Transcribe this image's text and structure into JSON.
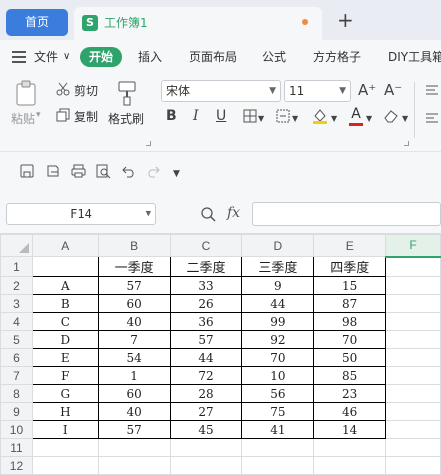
{
  "tabs": {
    "home": "首页",
    "doc_icon": "S",
    "doc_title": "工作簿1",
    "plus": "+"
  },
  "menu": {
    "file": "文件",
    "chevron": "∨",
    "start": "开始",
    "insert": "插入",
    "layout": "页面布局",
    "formula": "公式",
    "grid_tool": "方方格子",
    "diy": "DIY工具箱"
  },
  "ribbon": {
    "paste": "粘贴",
    "paste_arrow": "▾",
    "cut": "剪切",
    "copy": "复制",
    "format_painter": "格式刷",
    "font_name": "宋体",
    "font_size": "11",
    "bold": "B",
    "italic": "I",
    "underline": "U",
    "grow_font": "A⁺",
    "shrink_font": "A⁻",
    "font_color_letter": "A"
  },
  "namebox": {
    "value": "F14"
  },
  "formula": {
    "fx": "fx"
  },
  "sheet": {
    "columns": [
      "A",
      "B",
      "C",
      "D",
      "E",
      "F"
    ],
    "header_row": [
      "",
      "一季度",
      "二季度",
      "三季度",
      "四季度"
    ],
    "rows": [
      [
        "A",
        "57",
        "33",
        "9",
        "15"
      ],
      [
        "B",
        "60",
        "26",
        "44",
        "87"
      ],
      [
        "C",
        "40",
        "36",
        "99",
        "98"
      ],
      [
        "D",
        "7",
        "57",
        "92",
        "70"
      ],
      [
        "E",
        "54",
        "44",
        "70",
        "50"
      ],
      [
        "F",
        "1",
        "72",
        "10",
        "85"
      ],
      [
        "G",
        "60",
        "28",
        "56",
        "23"
      ],
      [
        "H",
        "40",
        "27",
        "75",
        "46"
      ],
      [
        "I",
        "57",
        "45",
        "41",
        "14"
      ]
    ],
    "row_numbers": [
      "1",
      "2",
      "3",
      "4",
      "5",
      "6",
      "7",
      "8",
      "9",
      "10",
      "11",
      "12"
    ],
    "selected_column": "F"
  },
  "colors": {
    "accent_green": "#2fa36c",
    "home_blue": "#3b7ddd",
    "tab_dot": "#f08a3c"
  }
}
